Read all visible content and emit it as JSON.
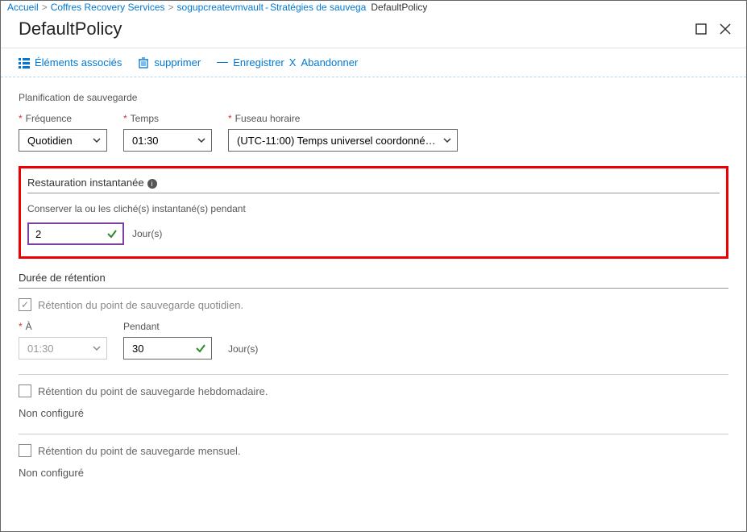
{
  "breadcrumb": {
    "home": "Accueil",
    "vaults": "Coffres Recovery Services",
    "vaultName": "sogupcreatevmvault",
    "policies": "Stratégies de sauvega",
    "current": "DefaultPolicy"
  },
  "title": "DefaultPolicy",
  "toolbar": {
    "associated": "Éléments associés",
    "delete": "supprimer",
    "save": "Enregistrer",
    "discard": "Abandonner"
  },
  "schedule": {
    "section": "Planification de sauvegarde",
    "frequency_label": "Fréquence",
    "frequency_value": "Quotidien",
    "time_label": "Temps",
    "time_value": "01:30",
    "tz_label": "Fuseau horaire",
    "tz_value": "(UTC-11:00) Temps universel coordonné…"
  },
  "restore": {
    "header": "Restauration instantanée",
    "keep_label": "Conserver la ou les cliché(s) instantané(s) pendant",
    "value": "2",
    "unit": "Jour(s)"
  },
  "retention": {
    "header": "Durée de rétention",
    "daily": "Rétention du point de sauvegarde quotidien.",
    "at_label": "À",
    "at_value": "01:30",
    "for_label": "Pendant",
    "for_value": "30",
    "unit": "Jour(s)",
    "weekly": "Rétention du point de sauvegarde hebdomadaire.",
    "monthly": "Rétention du point de sauvegarde mensuel.",
    "not_configured": "Non configuré"
  }
}
